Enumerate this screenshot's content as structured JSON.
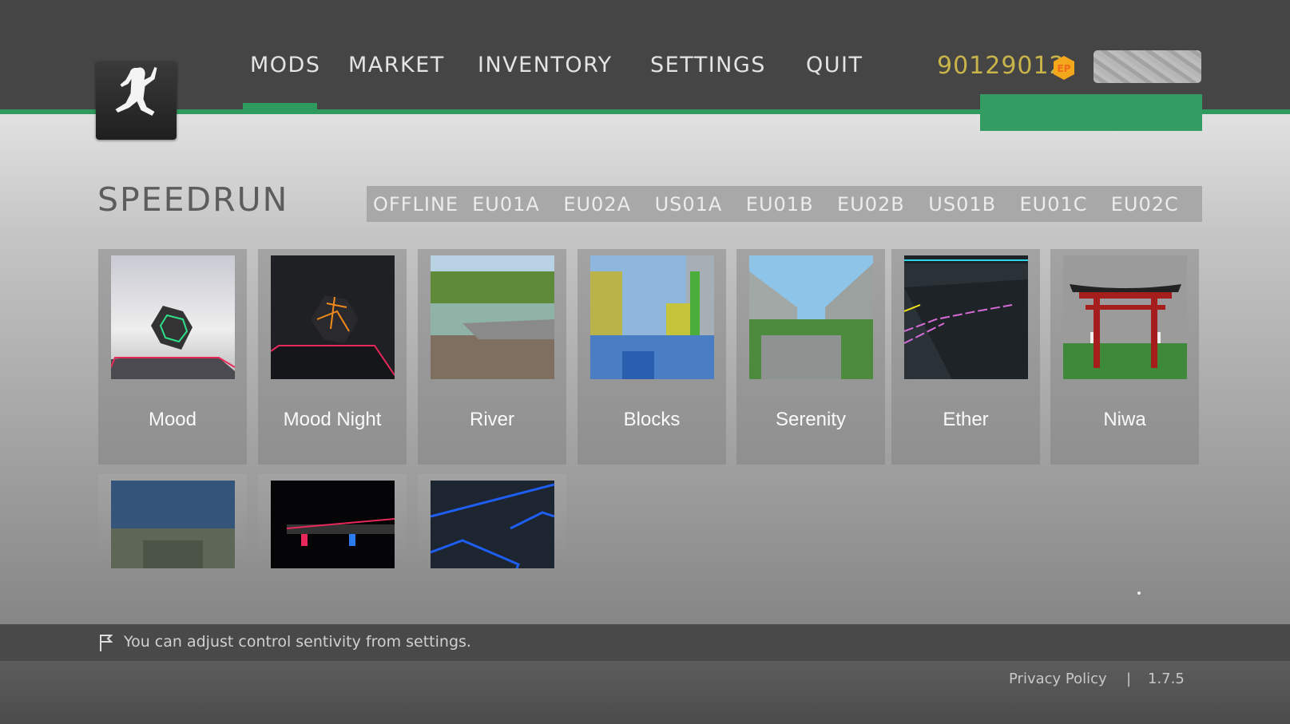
{
  "header": {
    "nav": [
      "MODS",
      "MARKET",
      "INVENTORY",
      "SETTINGS",
      "QUIT"
    ],
    "active_nav": "MODS",
    "coins": "90129012",
    "currency_icon": "ep-coin-icon",
    "currency_label": "EP"
  },
  "mode": {
    "title": "SPEEDRUN",
    "servers": [
      "OFFLINE",
      "EU01A",
      "EU02A",
      "US01A",
      "EU01B",
      "EU02B",
      "US01B",
      "EU01C",
      "EU02C"
    ]
  },
  "maps": [
    {
      "label": "Mood"
    },
    {
      "label": "Mood Night"
    },
    {
      "label": "River"
    },
    {
      "label": "Blocks"
    },
    {
      "label": "Serenity"
    },
    {
      "label": "Ether"
    },
    {
      "label": "Niwa"
    },
    {
      "label": ""
    },
    {
      "label": ""
    },
    {
      "label": ""
    }
  ],
  "tip": {
    "icon": "flag-icon",
    "text": "You can adjust control sentivity from settings."
  },
  "footer": {
    "privacy": "Privacy Policy",
    "separator": "|",
    "version": "1.7.5"
  },
  "colors": {
    "accent": "#2f9a5d",
    "header": "#454545",
    "coins": "#c9b44a"
  }
}
